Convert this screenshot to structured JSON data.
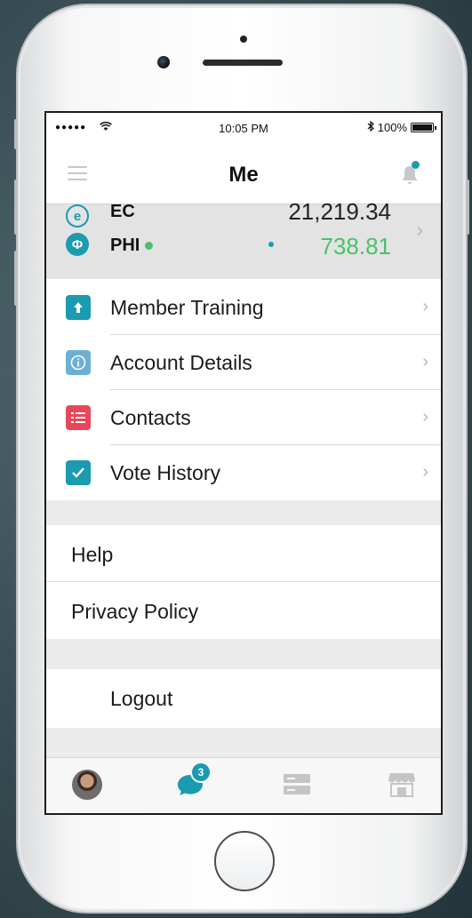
{
  "status_bar": {
    "signal": "●●●●●",
    "time": "10:05 PM",
    "battery": "100%"
  },
  "nav": {
    "title": "Me",
    "notification_dot": true
  },
  "wallet": {
    "coins": [
      {
        "symbol": "e",
        "name": "EC",
        "value": "21,219.34",
        "color": "#222222"
      },
      {
        "symbol": "Φ",
        "name": "PHI",
        "value": "738.81",
        "color": "#4cc06a"
      }
    ]
  },
  "menu": {
    "items": [
      {
        "label": "Member Training",
        "icon": "upload-icon",
        "icon_glyph": "↑",
        "icon_color": "#1a9bb0"
      },
      {
        "label": "Account Details",
        "icon": "info-icon",
        "icon_glyph": "ⓘ",
        "icon_color": "#6bb0d4"
      },
      {
        "label": "Contacts",
        "icon": "list-icon",
        "icon_glyph": "☰",
        "icon_color": "#e8475a"
      },
      {
        "label": "Vote History",
        "icon": "check-icon",
        "icon_glyph": "✓",
        "icon_color": "#1a9bb0"
      }
    ],
    "chevron": "›"
  },
  "secondary": {
    "help": "Help",
    "privacy": "Privacy Policy",
    "logout": "Logout"
  },
  "tabs": {
    "chat_badge": "3",
    "accent": "#1a9bb0"
  }
}
